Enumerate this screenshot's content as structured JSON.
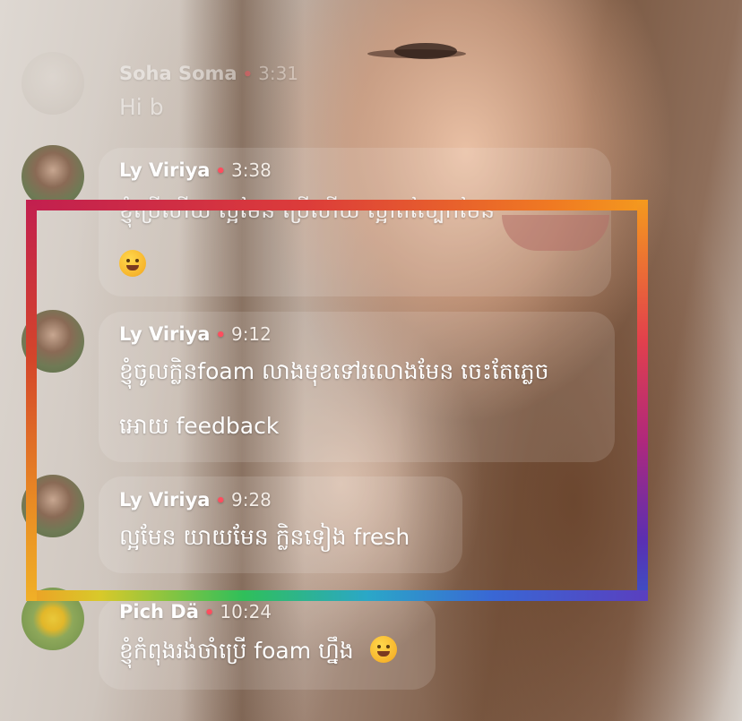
{
  "comments": [
    {
      "name": "Soha Soma",
      "time": "3:31",
      "lines": [
        "Hi b"
      ]
    },
    {
      "name": "Ly Viriya",
      "time": "3:38",
      "lines": [
        "ខ្ញុំប្រើហើយ​ ល្អមែន ប្រើហើយ​ ស្អាតស្បែកមែន"
      ],
      "emoji": "rolling-on-floor-laughing"
    },
    {
      "name": "Ly Viriya",
      "time": "9:12",
      "lines": [
        "ខ្ញុំចូលក្លិនfoam លាងមុខទៅរលោងមែន ចេះតែភ្លេច",
        "អោយ feedback"
      ]
    },
    {
      "name": "Ly Viriya",
      "time": "9:28",
      "lines": [
        "ល្អមែន យាយមែន ក្លិនទៀង fresh"
      ]
    },
    {
      "name": "Pich Dä",
      "time": "10:24",
      "lines": [
        "ខ្ញុំកំពុងរង់ចាំប្រើ foam ហ្នឹង"
      ],
      "emoji": "smiling-face"
    }
  ],
  "separator_dot": "•",
  "colors": {
    "dot": "#ff4d5e",
    "bubble": "rgba(255,255,255,0.13)"
  }
}
